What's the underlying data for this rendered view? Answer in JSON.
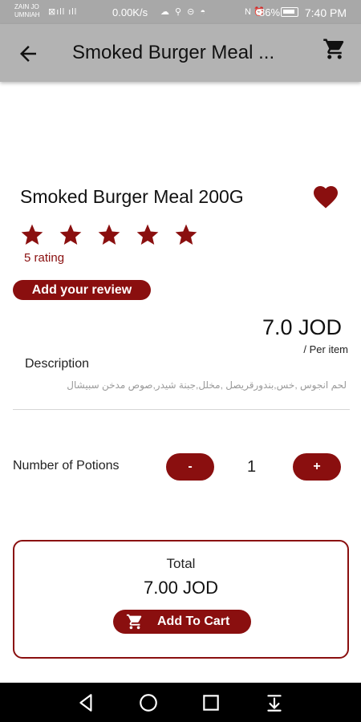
{
  "status_bar": {
    "carrier": "ZAIN JO\nUMNIAH",
    "net_speed": "0.00K/s",
    "battery": "86%",
    "time": "7:40 PM"
  },
  "app_bar": {
    "title": "Smoked Burger Meal ..."
  },
  "product": {
    "name": "Smoked Burger Meal 200G",
    "rating_text": "5 rating",
    "stars": 5,
    "review_button": "Add your review",
    "price": "7.0 JOD",
    "per_item": "/ Per item",
    "description_label": "Description",
    "description": "لحم انجوس ,خس,بندورقريصل ,مخلل,جبنة شيدر,صوص مدخن سبيشال"
  },
  "portions": {
    "label": "Number of Potions",
    "minus": "-",
    "plus": "+",
    "quantity": "1"
  },
  "total": {
    "label": "Total",
    "value": "7.00 JOD",
    "add_to_cart": "Add To Cart"
  },
  "colors": {
    "accent": "#8a0f0f",
    "app_bar": "#b3b3b3"
  }
}
